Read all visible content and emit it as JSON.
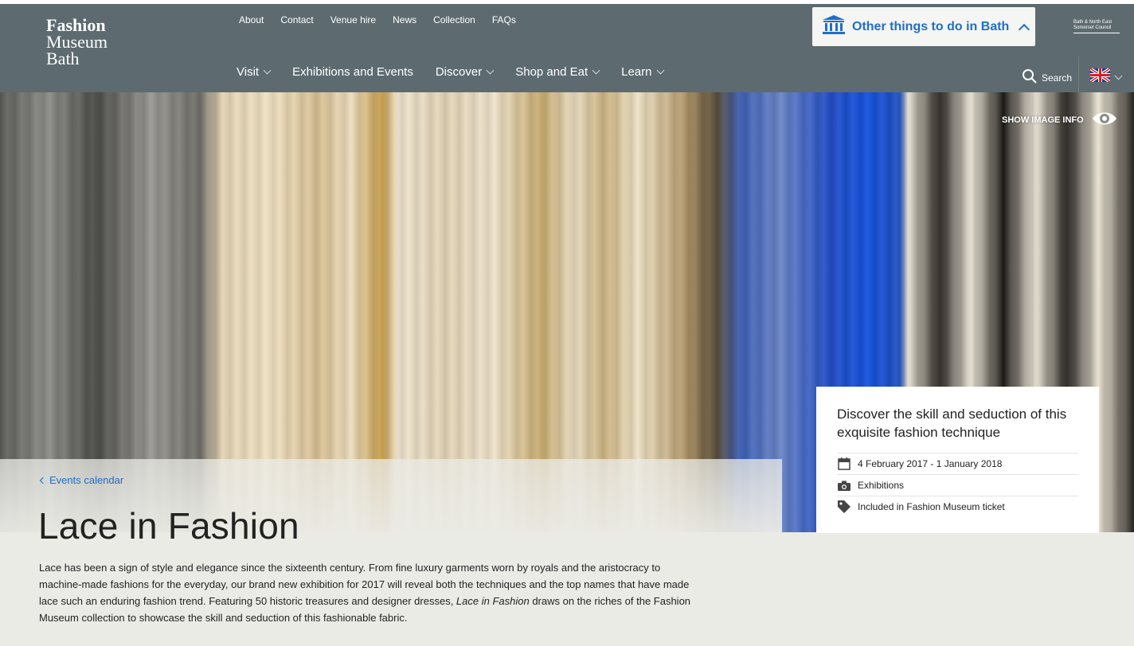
{
  "logo": {
    "line1": "Fashion",
    "line2": "Museum",
    "line3": "Bath"
  },
  "utility_nav": [
    "About",
    "Contact",
    "Venue hire",
    "News",
    "Collection",
    "FAQs"
  ],
  "main_nav": [
    {
      "label": "Visit",
      "dropdown": true
    },
    {
      "label": "Exhibitions and Events",
      "dropdown": false
    },
    {
      "label": "Discover",
      "dropdown": true
    },
    {
      "label": "Shop and Eat",
      "dropdown": true
    },
    {
      "label": "Learn",
      "dropdown": true
    }
  ],
  "other_things": {
    "label": "Other things to do in Bath",
    "icon": "building-columns-icon"
  },
  "council": {
    "line1": "Bath & North East",
    "line2": "Somerset Council"
  },
  "search": {
    "label": "Search",
    "icon": "search-icon"
  },
  "language": {
    "icon": "uk-flag-icon"
  },
  "hero": {
    "image_info_label": "SHOW IMAGE INFO",
    "icon": "eye-icon"
  },
  "breadcrumb": {
    "label": "Events calendar"
  },
  "page_title": "Lace in Fashion",
  "body": {
    "part1": "Lace has been a sign of style and elegance since the sixteenth century. From fine luxury garments worn by royals and the aristocracy to machine-made fashions for the everyday, our brand new exhibition for 2017 will reveal both the techniques and the top names that have made lace such an enduring fashion trend. Featuring 50 historic treasures and designer dresses, ",
    "emphasis": "Lace in Fashion",
    "part2": " draws on the riches of the Fashion Museum collection to showcase the skill and seduction of this fashionable fabric."
  },
  "card": {
    "tagline": "Discover the skill and seduction of this exquisite fashion technique",
    "dates": "4 February 2017 - 1 January 2018",
    "category": "Exhibitions",
    "price": "Included in Fashion Museum ticket"
  },
  "colors": {
    "header": "#5d6b70",
    "link": "#1f6fc8",
    "background": "#ebebe6"
  }
}
